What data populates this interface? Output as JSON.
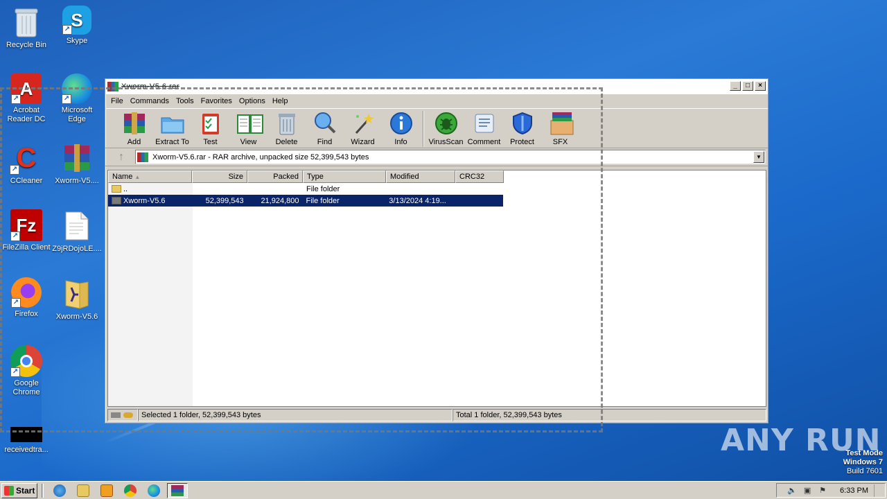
{
  "desktop": {
    "icons": [
      {
        "label": "Recycle Bin",
        "icon": "recycle-bin-icon"
      },
      {
        "label": "Skype",
        "icon": "skype-icon"
      },
      {
        "label": "Acrobat Reader DC",
        "icon": "acrobat-icon"
      },
      {
        "label": "Microsoft Edge",
        "icon": "edge-icon"
      },
      {
        "label": "CCleaner",
        "icon": "ccleaner-icon"
      },
      {
        "label": "Xworm-V5....",
        "icon": "winrar-archive-icon"
      },
      {
        "label": "FileZilla Client",
        "icon": "filezilla-icon"
      },
      {
        "label": "Z9jRDojoLE....",
        "icon": "document-icon"
      },
      {
        "label": "Firefox",
        "icon": "firefox-icon"
      },
      {
        "label": "Xworm-V5.6",
        "icon": "folder-icon"
      },
      {
        "label": "Google Chrome",
        "icon": "chrome-icon"
      },
      {
        "label": "receivedtra...",
        "icon": "file-icon"
      }
    ],
    "watermark": "ANY RUN",
    "test_mode": {
      "line1": "Test Mode",
      "line2": "Windows 7",
      "line3": "Build 7601"
    }
  },
  "window": {
    "title": "Xworm-V5.6.rar",
    "menu": [
      "File",
      "Commands",
      "Tools",
      "Favorites",
      "Options",
      "Help"
    ],
    "toolbar": [
      "Add",
      "Extract To",
      "Test",
      "View",
      "Delete",
      "Find",
      "Wizard",
      "Info",
      "VirusScan",
      "Comment",
      "Protect",
      "SFX"
    ],
    "address": "Xworm-V5.6.rar - RAR archive, unpacked size 52,399,543 bytes",
    "columns": [
      "Name",
      "Size",
      "Packed",
      "Type",
      "Modified",
      "CRC32"
    ],
    "rows": [
      {
        "name": "..",
        "size": "",
        "packed": "",
        "type": "File folder",
        "modified": "",
        "crc": ""
      },
      {
        "name": "Xworm-V5.6",
        "size": "52,399,543",
        "packed": "21,924,800",
        "type": "File folder",
        "modified": "3/13/2024 4:19...",
        "crc": ""
      }
    ],
    "status_left": "Selected 1 folder, 52,399,543 bytes",
    "status_right": "Total 1 folder, 52,399,543 bytes"
  },
  "taskbar": {
    "start_label": "Start",
    "clock": "6:33 PM"
  }
}
